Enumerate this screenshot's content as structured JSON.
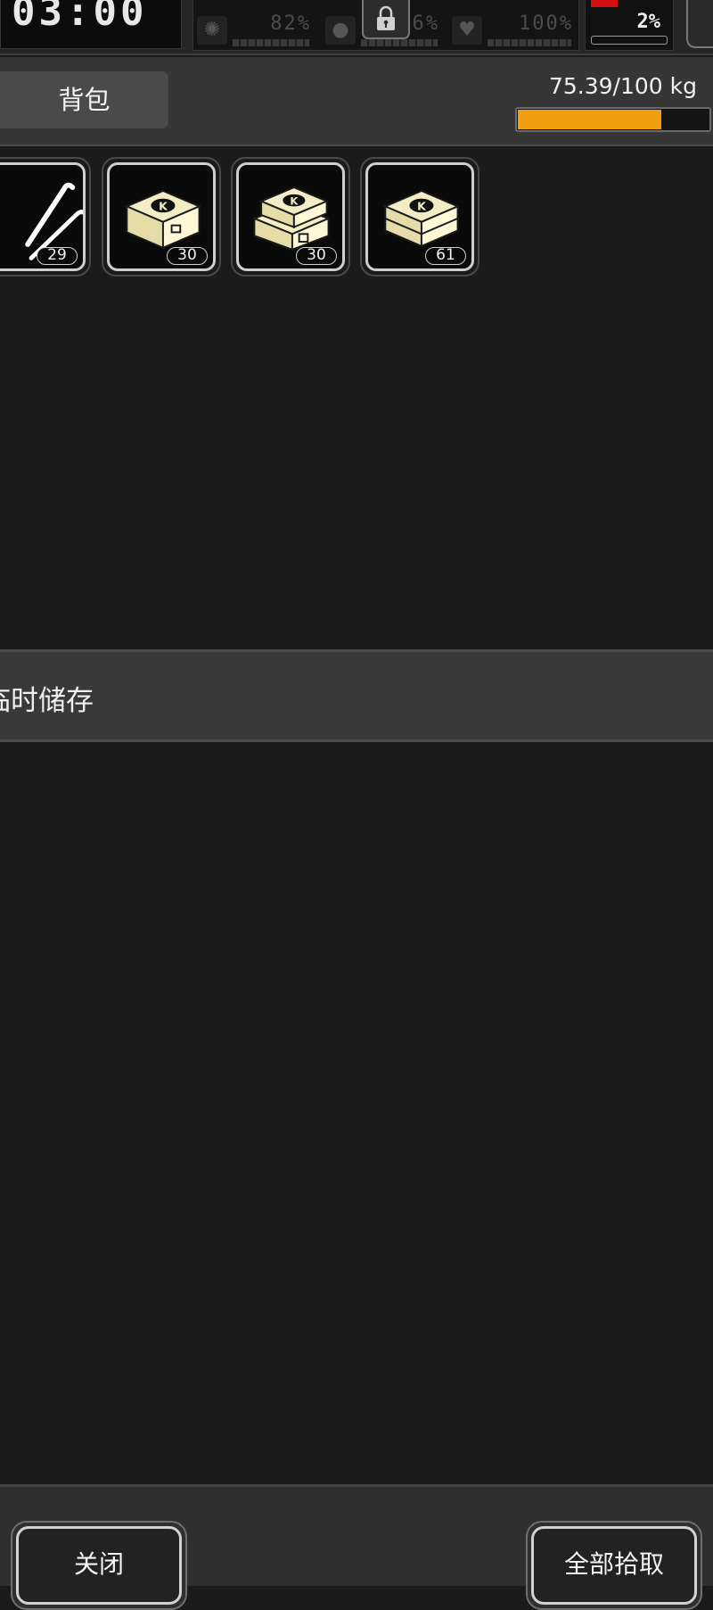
{
  "status": {
    "clock": "03:00",
    "stats": [
      {
        "icon": "brain-icon",
        "value": "82%"
      },
      {
        "icon": "water-drop-icon",
        "value": "6%"
      },
      {
        "icon": "heart-icon",
        "value": "100%"
      }
    ],
    "right_value": "2%"
  },
  "backpack": {
    "title": "背包",
    "weight": "75.39/100 kg",
    "weight_fraction": 0.7539,
    "items": [
      {
        "icon": "lockpick-icon",
        "count": "29"
      },
      {
        "icon": "ammo-box-icon",
        "count": "30"
      },
      {
        "icon": "ammo-box-stack-icon",
        "count": "30"
      },
      {
        "icon": "ammo-box-icon",
        "count": "61"
      }
    ]
  },
  "storage": {
    "title": "临时储存"
  },
  "footer": {
    "close_label": "关闭",
    "pickup_all_label": "全部拾取"
  },
  "colors": {
    "weight_bar": "#f09e10",
    "alert": "#d40f0f",
    "item_cream": "#f4ecc4"
  }
}
